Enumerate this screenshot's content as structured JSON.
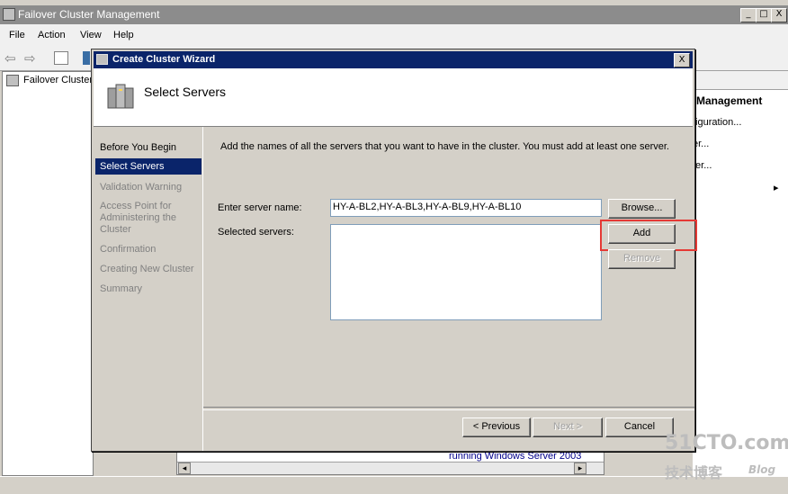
{
  "main_window": {
    "title": "Failover Cluster Management",
    "controls": [
      "_",
      "□",
      "X"
    ],
    "menu": [
      "File",
      "Action",
      "View",
      "Help"
    ],
    "tree_root": "Failover Cluster",
    "actions_header": "Management",
    "actions": [
      "figuration...",
      "er...",
      "ter..."
    ],
    "actions_more": "▸",
    "center_text": "running Windows Server 2003",
    "scroll_left": "◂",
    "scroll_right": "▸"
  },
  "wizard": {
    "title": "Create Cluster Wizard",
    "heading": "Select Servers",
    "close": "X",
    "steps": [
      {
        "label": "Before You Begin",
        "state": "enabled"
      },
      {
        "label": "Select Servers",
        "state": "current"
      },
      {
        "label": "Validation Warning",
        "state": "disabled"
      },
      {
        "label": "Access Point for Administering the Cluster",
        "state": "disabled"
      },
      {
        "label": "Confirmation",
        "state": "disabled"
      },
      {
        "label": "Creating New Cluster",
        "state": "disabled"
      },
      {
        "label": "Summary",
        "state": "disabled"
      }
    ],
    "instruction": "Add the names of all the servers that you want to have in the cluster. You must add at least one server.",
    "server_name_label": "Enter server name:",
    "server_name_value": "HY-A-BL2,HY-A-BL3,HY-A-BL9,HY-A-BL10",
    "selected_servers_label": "Selected servers:",
    "browse_button": "Browse...",
    "add_button": "Add",
    "remove_button": "Remove",
    "previous_button": "< Previous",
    "next_button": "Next >",
    "cancel_button": "Cancel"
  },
  "watermark": {
    "top": "51CTO.com",
    "bottom": "技术博客",
    "suffix": "Blog"
  },
  "colors": {
    "wizard_title_bg": "#0a246a",
    "highlight": "#e53935",
    "current_step_bg": "#0a246a"
  }
}
